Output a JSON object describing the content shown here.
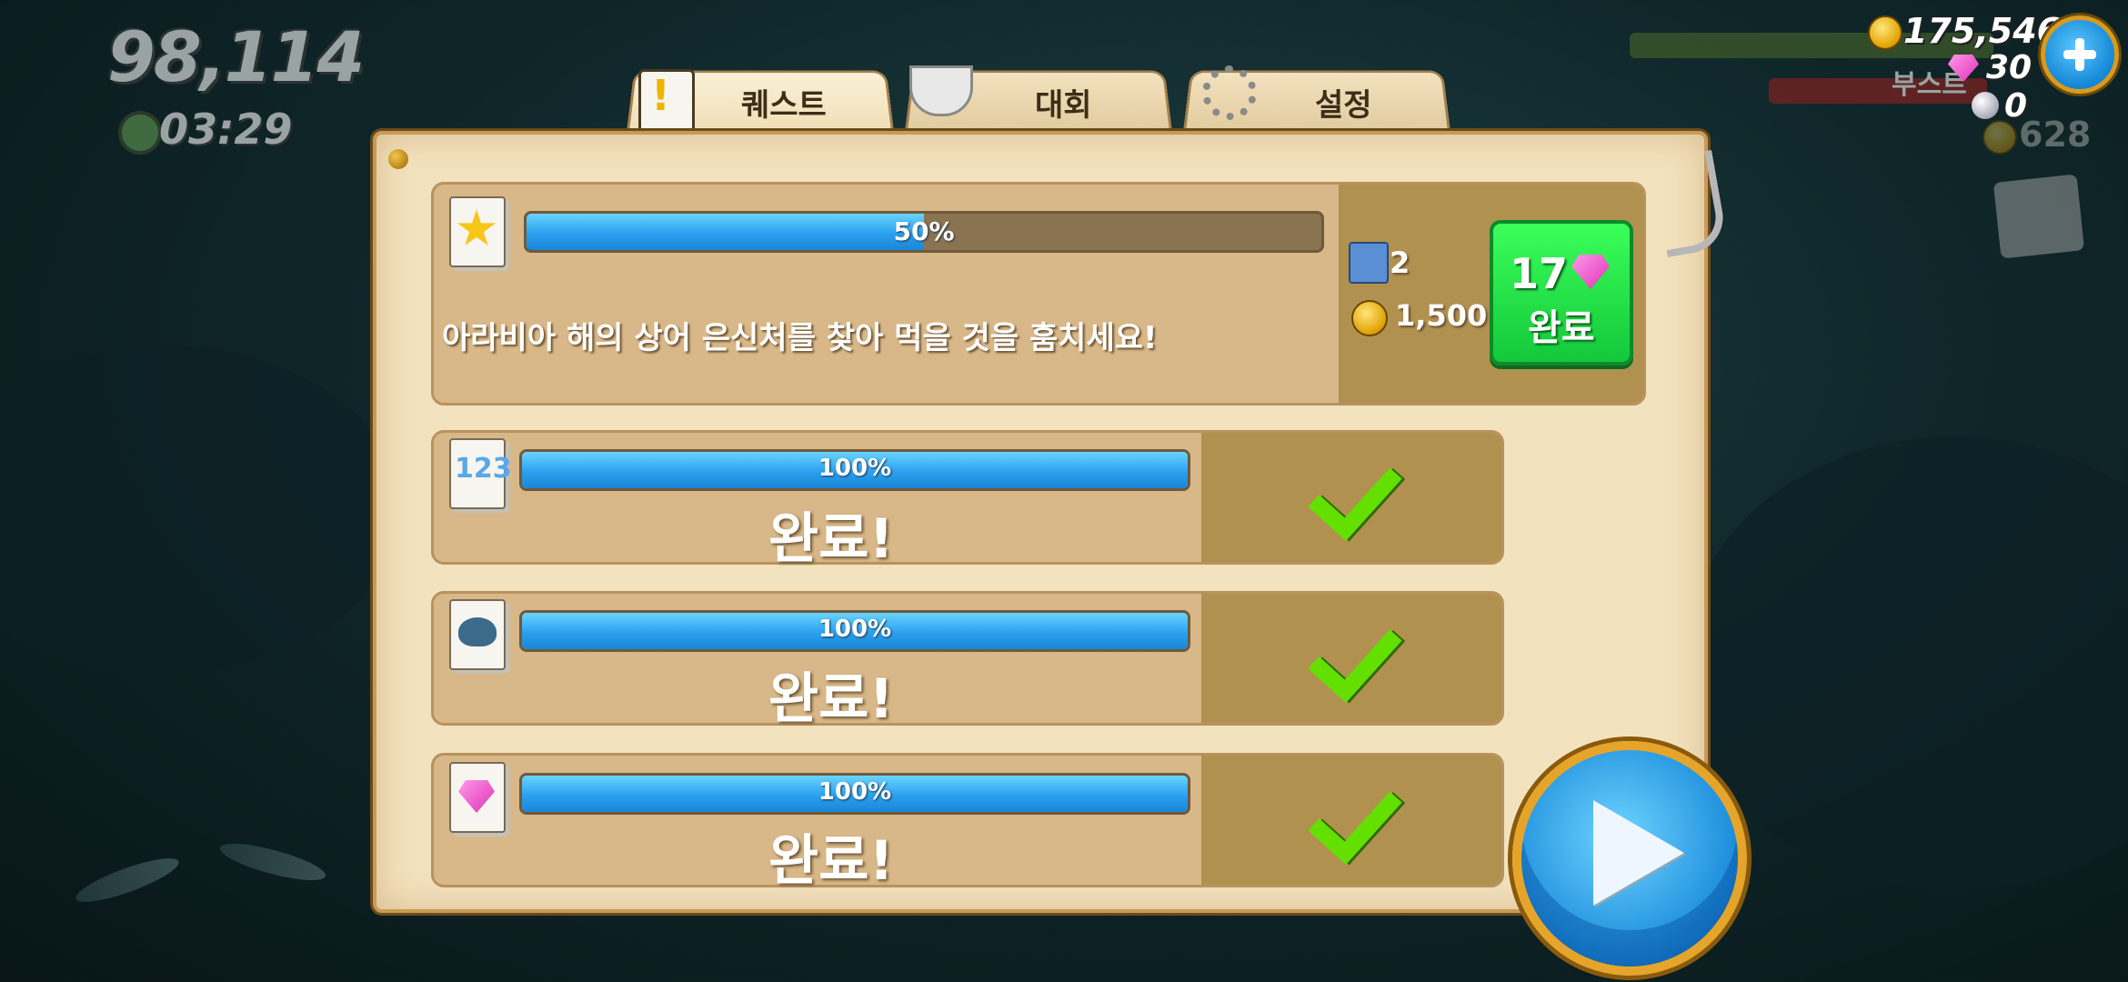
{
  "hud": {
    "score": "98,114",
    "timer": "03:29",
    "coins": "175,546",
    "gems": "30",
    "pearls": "0",
    "boost_label": "부스트",
    "dim_coins": "628"
  },
  "tabs": [
    {
      "label": "퀘스트",
      "icon": "quest-scroll-icon",
      "active": true
    },
    {
      "label": "대회",
      "icon": "trophy-icon",
      "active": false
    },
    {
      "label": "설정",
      "icon": "gears-icon",
      "active": false
    }
  ],
  "quests": {
    "active": {
      "icon": "starfish-icon",
      "progress": 50,
      "progress_label": "50%",
      "description": "아라비아 해의 상어 은신처를 찾아 먹을 것을 훔치세요!",
      "reward_map": "2",
      "reward_coins": "1,500",
      "complete_cost": "17",
      "complete_label": "완료"
    },
    "completed": [
      {
        "icon": "numbers-icon",
        "progress": 100,
        "progress_label": "100%",
        "status": "완료!"
      },
      {
        "icon": "shark-icon",
        "progress": 100,
        "progress_label": "100%",
        "status": "완료!"
      },
      {
        "icon": "gems-icon",
        "progress": 100,
        "progress_label": "100%",
        "status": "완료!"
      }
    ]
  },
  "colors": {
    "panel": "#f3e2be",
    "card": "#d8b888",
    "progress": "#2aa0ef",
    "complete_button": "#13c83a",
    "check": "#63e000"
  }
}
